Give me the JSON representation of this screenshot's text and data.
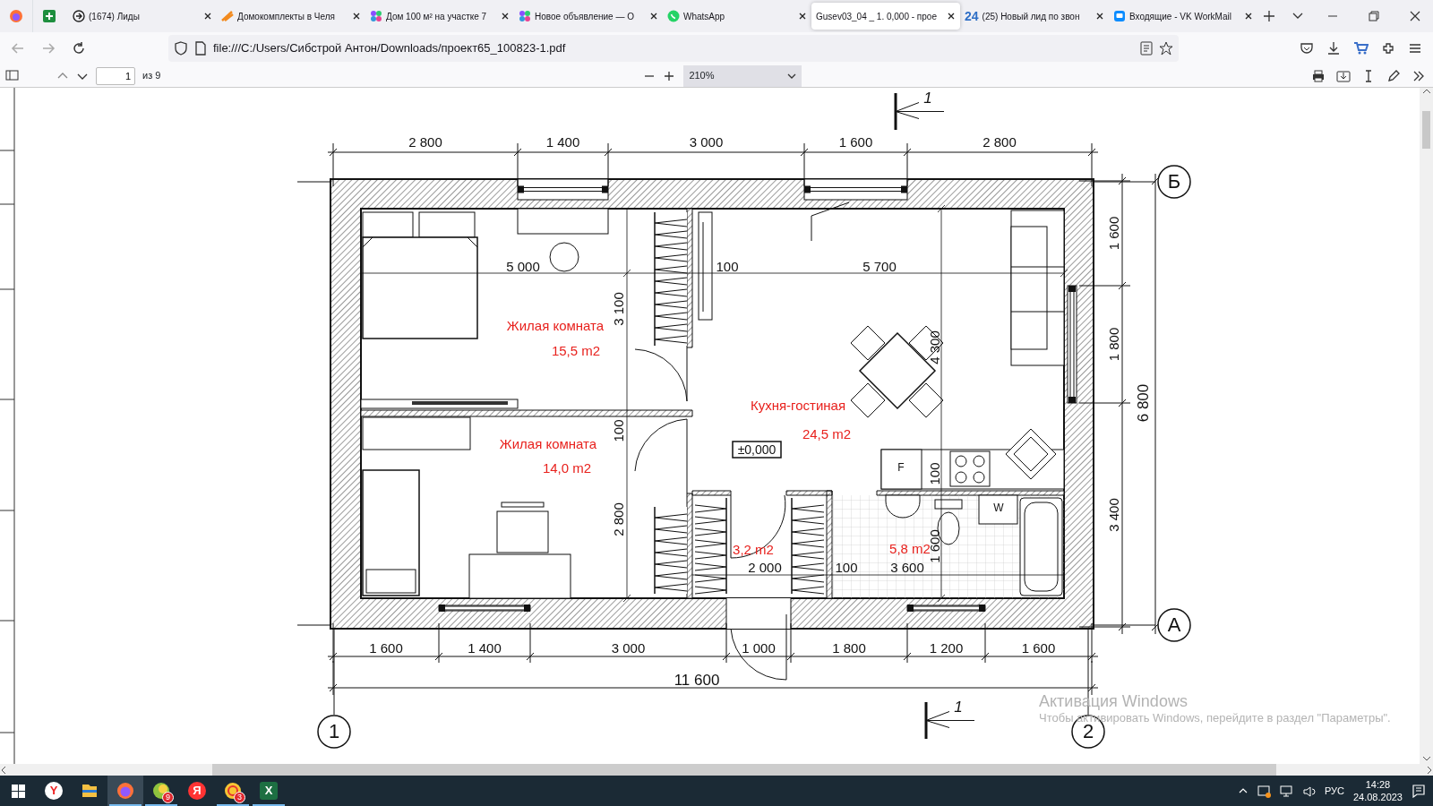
{
  "tabs": [
    {
      "title": "(1674) Лиды",
      "selected": false
    },
    {
      "title": "Домокомплекты в Челя",
      "selected": false
    },
    {
      "title": "Дом 100 м² на участке 7",
      "selected": false
    },
    {
      "title": "Новое объявление — О",
      "selected": false
    },
    {
      "title": "WhatsApp",
      "selected": false
    },
    {
      "title": "Gusev03_04 _ 1. 0,000 - прое",
      "selected": true
    },
    {
      "logo": "24",
      "title": "(25) Новый лид по звон",
      "selected": false
    },
    {
      "title": "Входящие - VK WorkMail",
      "selected": false
    }
  ],
  "address": "file:///C:/Users/Сибстрой Антон/Downloads/проект65_100823-1.pdf",
  "pdf_toolbar": {
    "page": "1",
    "page_count": "из 9",
    "zoom": "210%"
  },
  "plan": {
    "dims_top": [
      "2 800",
      "1 400",
      "3 000",
      "1 600",
      "2 800"
    ],
    "dims_bottom": [
      "1 600",
      "1 400",
      "3 000",
      "1 000",
      "1 800",
      "1 200",
      "1 600"
    ],
    "total": "11 600",
    "dims_right": [
      "1 600",
      "1 800",
      "3 400"
    ],
    "overall_right": "6 800",
    "axes": [
      "Б",
      "А",
      "1",
      "2"
    ],
    "section_marks": [
      "1",
      "1"
    ],
    "rooms": [
      {
        "name": "Жилая комната",
        "area": "15,5 m2"
      },
      {
        "name": "Жилая комната",
        "area": "14,0 m2"
      },
      {
        "name": "Кухня-гостиная",
        "area": "24,5 m2"
      },
      {
        "area": "3,2 m2"
      },
      {
        "area": "5,8 m2"
      }
    ],
    "inner_dims": [
      "5 000",
      "100",
      "5 700",
      "3 100",
      "100",
      "2 800",
      "4 300",
      "100",
      "1 600",
      "2 000",
      "100",
      "3 600"
    ],
    "level_mark": "±0,000",
    "appliance_marks": [
      "F",
      "W"
    ]
  },
  "activation": {
    "title": "Активация Windows",
    "text": "Чтобы активировать Windows, перейдите в раздел \"Параметры\"."
  },
  "taskbar": {
    "apps": [
      {
        "running": false,
        "active": false,
        "glyph": "Y"
      },
      {
        "running": false,
        "active": false
      },
      {
        "running": true,
        "active": true
      },
      {
        "running": true,
        "active": false,
        "badge": "9"
      },
      {
        "running": false,
        "active": false,
        "glyph": "Я"
      },
      {
        "running": true,
        "active": false,
        "badge": "3"
      },
      {
        "running": true,
        "active": false,
        "glyph": "X"
      }
    ],
    "language": "РУС",
    "time": "14:28",
    "date": "24.08.2023"
  }
}
